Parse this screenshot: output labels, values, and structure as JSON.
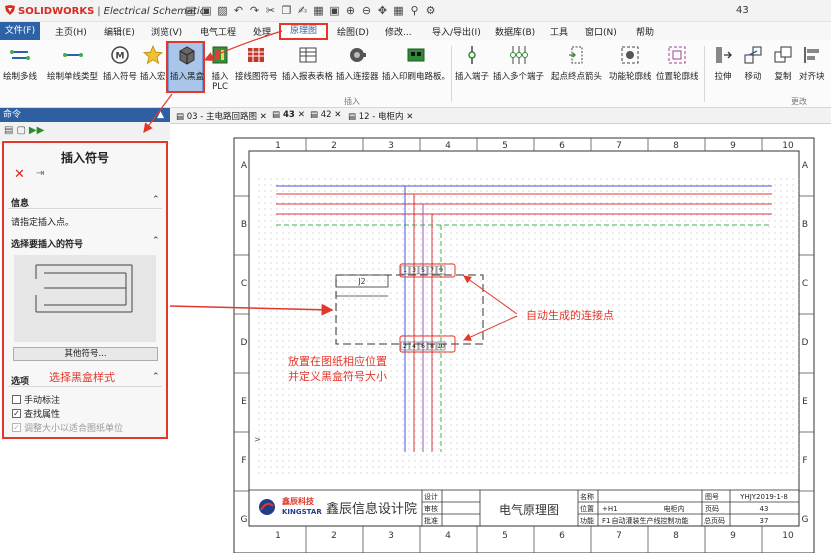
{
  "app": {
    "brand": "SOLIDWORKS",
    "product": "Electrical Schematic",
    "page_number": "43"
  },
  "menu": {
    "file": "文件(F)",
    "items": [
      "主页(H)",
      "编辑(E)",
      "浏览(V)",
      "电气工程",
      "处理",
      "原理图",
      "绘图(D)",
      "修改...",
      "导入/导出(I)",
      "数据库(B)",
      "工具",
      "窗口(N)",
      "帮助"
    ],
    "active": "原理图"
  },
  "ribbon": {
    "buttons": [
      {
        "label": "绘制多线",
        "icon": "multi-line-icon"
      },
      {
        "label": "绘制单线类型",
        "icon": "single-line-icon"
      },
      {
        "label": "插入符号",
        "icon": "symbol-icon"
      },
      {
        "label": "插入宏",
        "icon": "star-macro-icon"
      },
      {
        "label": "插入黑盒",
        "icon": "black-box-icon"
      },
      {
        "label": "插入",
        "label2": "PLC",
        "icon": "plc-icon"
      },
      {
        "label": "接线图符号",
        "icon": "wiring-symbol-icon"
      },
      {
        "label": "插入报表表格",
        "icon": "report-table-icon"
      },
      {
        "label": "插入连接器",
        "icon": "connector-icon"
      },
      {
        "label": "插入印刷电路板。",
        "icon": "pcb-icon"
      },
      {
        "label": "插入端子",
        "icon": "terminal-icon"
      },
      {
        "label": "插入多个端子",
        "icon": "multi-terminal-icon"
      },
      {
        "label": "起点终点箭头",
        "icon": "origin-arrow-icon"
      },
      {
        "label": "功能轮廓线",
        "icon": "function-outline-icon"
      },
      {
        "label": "位置轮廓线",
        "icon": "location-outline-icon"
      },
      {
        "label": "拉伸",
        "icon": "stretch-icon"
      },
      {
        "label": "移动",
        "icon": "move-icon"
      },
      {
        "label": "复制",
        "icon": "copy-icon"
      },
      {
        "label": "对齐块",
        "icon": "align-icon"
      }
    ],
    "groups": [
      "插入",
      "更改"
    ]
  },
  "panel": {
    "header": "命令",
    "title": "插入符号",
    "info_heading": "信息",
    "info_text": "请指定插入点。",
    "symbol_heading": "选择要插入的符号",
    "more_button": "其他符号...",
    "options_heading": "选项",
    "options": [
      {
        "label": "手动标注",
        "checked": false,
        "enabled": true
      },
      {
        "label": "查找属性",
        "checked": true,
        "enabled": true
      },
      {
        "label": "调整大小以适合图纸单位",
        "checked": true,
        "enabled": false
      }
    ]
  },
  "tabs": [
    {
      "label": "03 - 主电路回路图",
      "active": false
    },
    {
      "label": "43",
      "active": true
    },
    {
      "label": "42",
      "active": false
    },
    {
      "label": "12 - 电柜内",
      "active": false
    }
  ],
  "drawing": {
    "columns": [
      "1",
      "2",
      "3",
      "4",
      "5",
      "6",
      "7",
      "8",
      "9",
      "10"
    ],
    "rows": [
      "A",
      "B",
      "C",
      "D",
      "E",
      "F",
      "G"
    ],
    "blackbox_label": "J2",
    "top_pins": [
      "1",
      "3",
      "5",
      "7",
      "9"
    ],
    "bottom_pins": [
      "2",
      "4",
      "6",
      "8",
      "10"
    ],
    "company_cn": "鑫辰科技",
    "company_en": "KINGSTAR",
    "institute": "鑫辰信息设计院",
    "sign_labels": [
      "设计",
      "审核",
      "批准"
    ],
    "sheet_title": "电气原理图",
    "info_labels": [
      "名称",
      "位置",
      "功能"
    ],
    "info_values": [
      "",
      "+H1",
      "F1"
    ],
    "info_desc": [
      "",
      "电柜内",
      "自动灌装生产线控制功能"
    ],
    "drawing_no_label": "图号",
    "drawing_no": "YHJY2019-1-8",
    "page_label": "页码",
    "page_value": "43",
    "total_label": "总页码",
    "total_value": "37"
  },
  "annotations": {
    "auto_points": "自动生成的连接点",
    "place_line1": "放置在图纸相应位置",
    "place_line2": "并定义黑盒符号大小",
    "choose_style": "选择黑盒样式"
  },
  "colors": {
    "accent": "#e2382b",
    "file_menu": "#2e62a6",
    "wire_blue": "#4b56d8",
    "wire_red": "#e23838",
    "wire_purple": "#a057b5",
    "wire_green": "#41b04a"
  }
}
